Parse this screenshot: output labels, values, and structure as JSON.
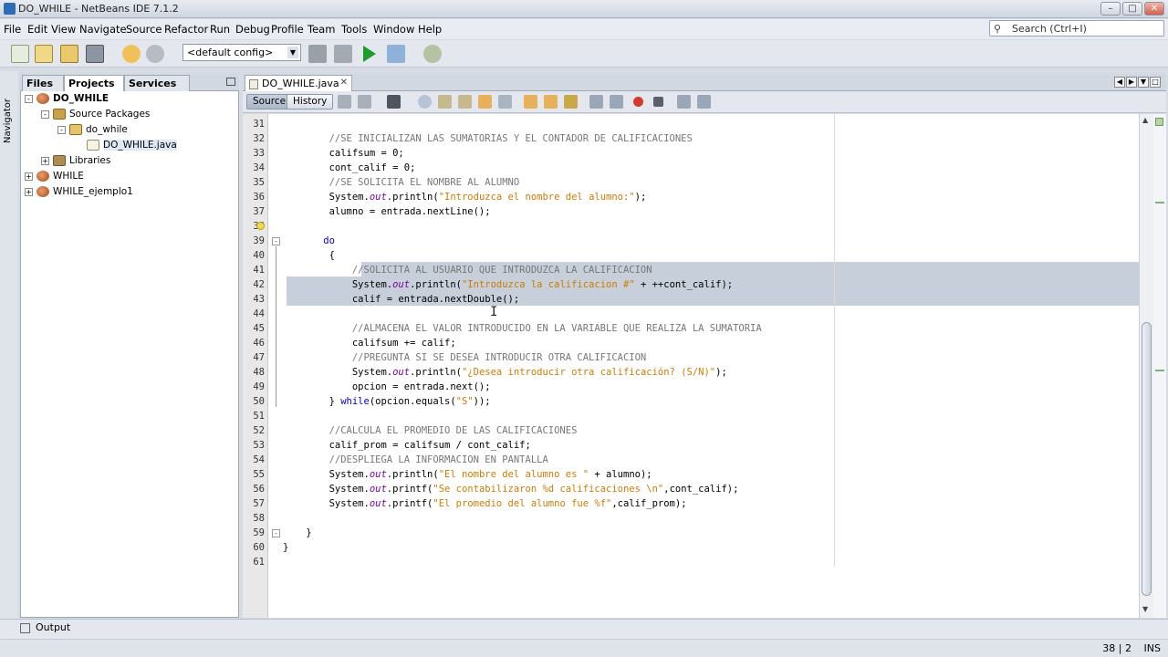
{
  "window": {
    "title": "DO_WHILE - NetBeans IDE 7.1.2"
  },
  "menu": [
    "File",
    "Edit",
    "View",
    "Navigate",
    "Source",
    "Refactor",
    "Run",
    "Debug",
    "Profile",
    "Team",
    "Tools",
    "Window",
    "Help"
  ],
  "search": {
    "placeholder": "Search (Ctrl+I)"
  },
  "toolbar": {
    "config": "<default config>"
  },
  "navigator_label": "Navigator",
  "panel_tabs": [
    "Files",
    "Projects",
    "Services"
  ],
  "tree": [
    {
      "label": "DO_WHILE",
      "type": "project"
    },
    {
      "label": "Source Packages",
      "type": "pkgs"
    },
    {
      "label": "do_while",
      "type": "pkg"
    },
    {
      "label": "DO_WHILE.java",
      "type": "file"
    },
    {
      "label": "Libraries",
      "type": "lib"
    },
    {
      "label": "WHILE",
      "type": "project"
    },
    {
      "label": "WHILE_ejemplo1",
      "type": "project"
    }
  ],
  "editor": {
    "tab": "DO_WHILE.java",
    "source_btn": "Source",
    "history_btn": "History",
    "line_numbers": [
      "31",
      "32",
      "33",
      "34",
      "35",
      "36",
      "37",
      "38",
      "39",
      "40",
      "41",
      "42",
      "43",
      "44",
      "45",
      "46",
      "47",
      "48",
      "49",
      "50",
      "51",
      "52",
      "53",
      "54",
      "55",
      "56",
      "57",
      "58",
      "59",
      "60",
      "61"
    ]
  },
  "code": [
    {
      "segs": []
    },
    {
      "segs": [
        {
          "t": "        //SE INICIALIZAN LAS SUMATORIAS Y EL CONTADOR DE CALIFICACIONES",
          "c": "cm"
        }
      ]
    },
    {
      "segs": [
        {
          "t": "        califsum = 0;"
        }
      ]
    },
    {
      "segs": [
        {
          "t": "        cont_calif = 0;"
        }
      ]
    },
    {
      "segs": [
        {
          "t": "        //SE SOLICITA EL NOMBRE AL ALUMNO",
          "c": "cm"
        }
      ]
    },
    {
      "segs": [
        {
          "t": "        System."
        },
        {
          "t": "out",
          "c": "it"
        },
        {
          "t": ".println("
        },
        {
          "t": "\"Introduzca el nombre del alumno:\"",
          "c": "st"
        },
        {
          "t": ");"
        }
      ]
    },
    {
      "segs": [
        {
          "t": "        alumno = entrada.nextLine();"
        }
      ]
    },
    {
      "segs": []
    },
    {
      "segs": [
        {
          "t": "       "
        },
        {
          "t": "do",
          "c": "kw"
        }
      ]
    },
    {
      "segs": [
        {
          "t": "        {"
        }
      ]
    },
    {
      "segs": [
        {
          "t": "            //SOLICITA AL USUARIO QUE INTRODUZCA LA CALIFICACION",
          "c": "cm"
        }
      ]
    },
    {
      "segs": [
        {
          "t": "            System."
        },
        {
          "t": "out",
          "c": "it"
        },
        {
          "t": ".println("
        },
        {
          "t": "\"Introduzca la calificacion #\"",
          "c": "st"
        },
        {
          "t": " + ++cont_calif);"
        }
      ]
    },
    {
      "segs": [
        {
          "t": "            calif = entrada.nextDouble();"
        }
      ]
    },
    {
      "segs": []
    },
    {
      "segs": [
        {
          "t": "            //ALMACENA EL VALOR INTRODUCIDO EN LA VARIABLE QUE REALIZA LA SUMATORIA",
          "c": "cm"
        }
      ]
    },
    {
      "segs": [
        {
          "t": "            califsum += calif;"
        }
      ]
    },
    {
      "segs": [
        {
          "t": "            //PREGUNTA SI SE DESEA INTRODUCIR OTRA CALIFICACION",
          "c": "cm"
        }
      ]
    },
    {
      "segs": [
        {
          "t": "            System."
        },
        {
          "t": "out",
          "c": "it"
        },
        {
          "t": ".println("
        },
        {
          "t": "\"¿Desea introducir otra calificación? (S/N)\"",
          "c": "st"
        },
        {
          "t": ");"
        }
      ]
    },
    {
      "segs": [
        {
          "t": "            opcion = entrada.next();"
        }
      ]
    },
    {
      "segs": [
        {
          "t": "        } "
        },
        {
          "t": "while",
          "c": "kw"
        },
        {
          "t": "(opcion.equals("
        },
        {
          "t": "\"S\"",
          "c": "st"
        },
        {
          "t": "));"
        }
      ]
    },
    {
      "segs": []
    },
    {
      "segs": [
        {
          "t": "        //CALCULA EL PROMEDIO DE LAS CALIFICACIONES",
          "c": "cm"
        }
      ]
    },
    {
      "segs": [
        {
          "t": "        calif_prom = califsum / cont_calif;"
        }
      ]
    },
    {
      "segs": [
        {
          "t": "        //DESPLIEGA LA INFORMACION EN PANTALLA",
          "c": "cm"
        }
      ]
    },
    {
      "segs": [
        {
          "t": "        System."
        },
        {
          "t": "out",
          "c": "it"
        },
        {
          "t": ".println("
        },
        {
          "t": "\"El nombre del alumno es \"",
          "c": "st"
        },
        {
          "t": " + alumno);"
        }
      ]
    },
    {
      "segs": [
        {
          "t": "        System."
        },
        {
          "t": "out",
          "c": "it"
        },
        {
          "t": ".printf("
        },
        {
          "t": "\"Se contabilizaron %d calificaciones \\n\"",
          "c": "st"
        },
        {
          "t": ",cont_calif);"
        }
      ]
    },
    {
      "segs": [
        {
          "t": "        System."
        },
        {
          "t": "out",
          "c": "it"
        },
        {
          "t": ".printf("
        },
        {
          "t": "\"El promedio del alumno fue %f\"",
          "c": "st"
        },
        {
          "t": ",calif_prom);"
        }
      ]
    },
    {
      "segs": []
    },
    {
      "segs": [
        {
          "t": "    }"
        }
      ]
    },
    {
      "segs": [
        {
          "t": "}"
        }
      ]
    },
    {
      "segs": []
    }
  ],
  "status": {
    "output": "Output",
    "position": "38 | 2",
    "mode": "INS"
  }
}
